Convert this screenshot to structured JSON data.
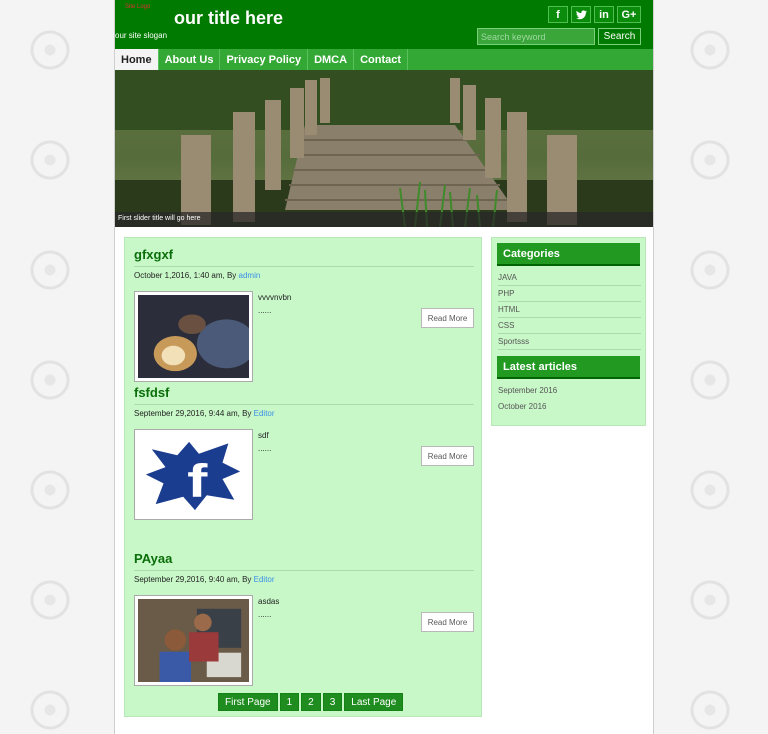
{
  "header": {
    "logo_text": "Site Logo",
    "site_title": "our title here",
    "slogan": "our site slogan",
    "social": [
      {
        "icon": "facebook-icon",
        "glyph": "f"
      },
      {
        "icon": "twitter-icon",
        "glyph": "t"
      },
      {
        "icon": "linkedin-icon",
        "glyph": "in"
      },
      {
        "icon": "googleplus-icon",
        "glyph": "G+"
      }
    ],
    "search_placeholder": "Search keyword",
    "search_button": "Search"
  },
  "nav": {
    "items": [
      "Home",
      "About Us",
      "Privacy Policy",
      "DMCA",
      "Contact"
    ],
    "active": "Home"
  },
  "slider": {
    "caption": "First slider title will go here"
  },
  "posts": [
    {
      "title": "gfxgxf",
      "date": "October 1,2016, 1:40 am, By",
      "author": "admin",
      "excerpt_line1": "vvvvnvbn",
      "excerpt_line2": "......",
      "read_more": "Read More"
    },
    {
      "title": "fsfdsf",
      "date": "September 29,2016, 9:44 am, By",
      "author": "Editor",
      "excerpt_line1": "sdf",
      "excerpt_line2": "......",
      "read_more": "Read More"
    },
    {
      "title": "PAyaa",
      "date": "September 29,2016, 9:40 am, By",
      "author": "Editor",
      "excerpt_line1": "asdas",
      "excerpt_line2": "......",
      "read_more": "Read More"
    }
  ],
  "pagination": {
    "first": "First Page",
    "pages": [
      "1",
      "2",
      "3"
    ],
    "last": "Last Page"
  },
  "sidebar": {
    "categories_title": "Categories",
    "categories": [
      "JAVA",
      "PHP",
      "HTML",
      "CSS",
      "Sportsss"
    ],
    "latest_title": "Latest articles",
    "latest": [
      "September 2016",
      "October 2016"
    ]
  },
  "colors": {
    "header_green": "#007a00",
    "nav_green": "#34a834",
    "content_bg": "#c8f8c8",
    "link_blue": "#3a8ee6"
  }
}
